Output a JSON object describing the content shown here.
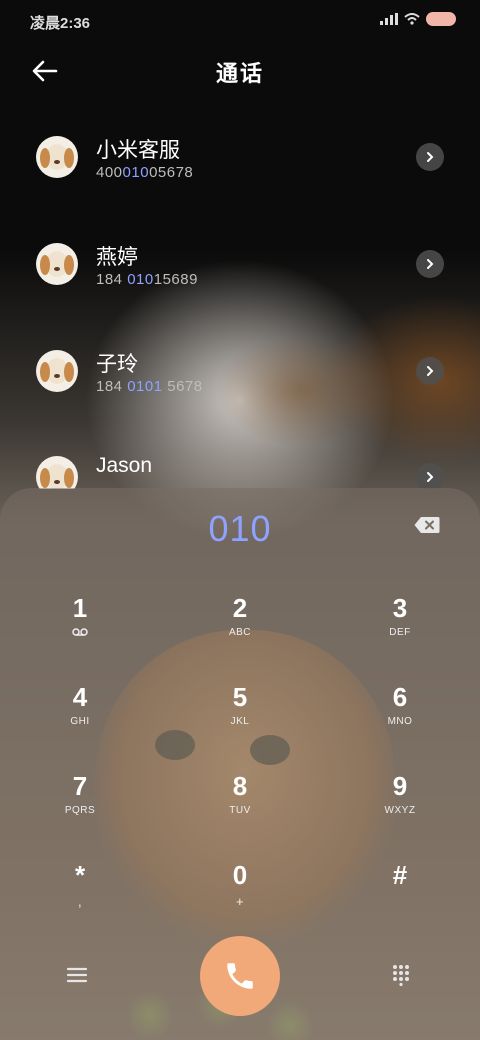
{
  "status_bar": {
    "time": "凌晨2:36"
  },
  "header": {
    "title": "通话"
  },
  "contacts": [
    {
      "name": "小米客服",
      "number_pre": "400",
      "number_match": "010",
      "number_post": "05678"
    },
    {
      "name": "燕婷",
      "number_pre": "184 ",
      "number_match": "010",
      "number_post": "15689"
    },
    {
      "name": "子玲",
      "number_pre": "184 ",
      "number_match": "0101",
      "number_post": " 5678"
    },
    {
      "name": "Jason",
      "number_pre": "",
      "number_match": "",
      "number_post": ""
    }
  ],
  "dialpad": {
    "input": "010",
    "keys": [
      {
        "digit": "1",
        "letters": ""
      },
      {
        "digit": "2",
        "letters": "ABC"
      },
      {
        "digit": "3",
        "letters": "DEF"
      },
      {
        "digit": "4",
        "letters": "GHI"
      },
      {
        "digit": "5",
        "letters": "JKL"
      },
      {
        "digit": "6",
        "letters": "MNO"
      },
      {
        "digit": "7",
        "letters": "PQRS"
      },
      {
        "digit": "8",
        "letters": "TUV"
      },
      {
        "digit": "9",
        "letters": "WXYZ"
      },
      {
        "digit": "*",
        "letters": ","
      },
      {
        "digit": "0",
        "letters": "+"
      },
      {
        "digit": "#",
        "letters": ""
      }
    ]
  },
  "colors": {
    "highlight": "#8ea2ff",
    "call_button": "#f1a979"
  }
}
